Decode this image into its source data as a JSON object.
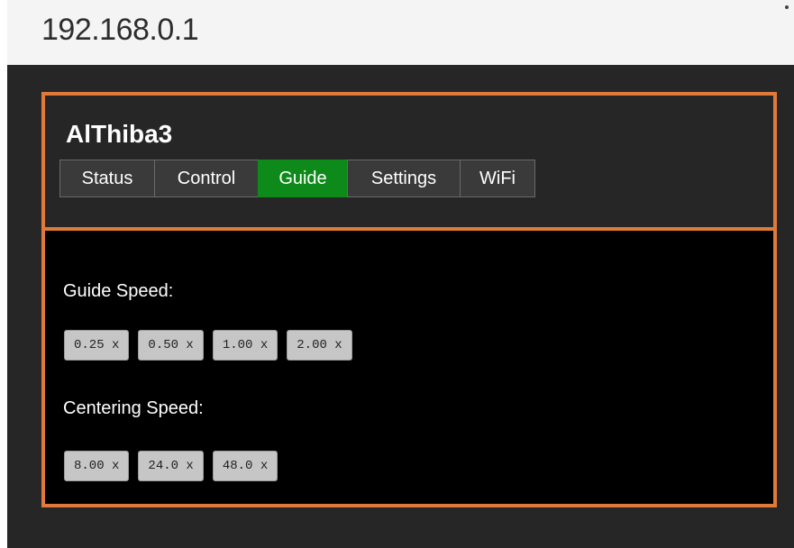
{
  "browser": {
    "address": "192.168.0.1"
  },
  "device": {
    "title": "AlThiba3"
  },
  "tabs": [
    {
      "label": "Status"
    },
    {
      "label": "Control"
    },
    {
      "label": "Guide",
      "active": true
    },
    {
      "label": "Settings"
    },
    {
      "label": "WiFi"
    }
  ],
  "guide": {
    "guide_speed_label": "Guide Speed:",
    "guide_speeds": [
      "0.25 x",
      "0.50 x",
      "1.00 x",
      "2.00 x"
    ],
    "centering_speed_label": "Centering Speed:",
    "centering_speeds": [
      "8.00 x",
      "24.0 x",
      "48.0 x"
    ]
  },
  "colors": {
    "accent_border": "#e07a3a",
    "active_tab": "#0d8a1a",
    "panel_bg": "#262626",
    "content_bg": "#000000"
  }
}
